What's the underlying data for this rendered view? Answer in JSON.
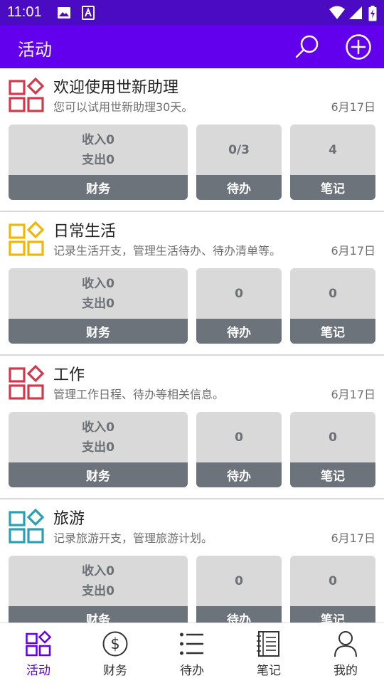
{
  "status_bar": {
    "time": "11:01"
  },
  "app_bar": {
    "title": "活动",
    "search_icon": "search-icon",
    "add_icon": "add-circle-icon"
  },
  "colors": {
    "primary": "#6200ee",
    "status_bar": "#4a0bc2",
    "tile_bg": "#d9d9d9",
    "tile_footer": "#6c737a"
  },
  "tile_labels": {
    "finance": "财务",
    "todo": "待办",
    "notes": "笔记"
  },
  "activities": [
    {
      "name": "欢迎使用世新助理",
      "description": "您可以试用世新助理30天。",
      "date": "6月17日",
      "icon_color": "#d13a4c",
      "income": "收入0",
      "expense": "支出0",
      "todo": "0/3",
      "notes": "4"
    },
    {
      "name": "日常生活",
      "description": "记录生活开支，管理生活待办、待办清单等。",
      "date": "6月17日",
      "icon_color": "#f2b705",
      "income": "收入0",
      "expense": "支出0",
      "todo": "0",
      "notes": "0"
    },
    {
      "name": "工作",
      "description": "管理工作日程、待办等相关信息。",
      "date": "6月17日",
      "icon_color": "#d13a4c",
      "income": "收入0",
      "expense": "支出0",
      "todo": "0",
      "notes": "0"
    },
    {
      "name": "旅游",
      "description": "记录旅游开支，管理旅游计划。",
      "date": "6月17日",
      "icon_color": "#2a9fb5",
      "income": "收入0",
      "expense": "支出0",
      "todo": "0",
      "notes": "0"
    }
  ],
  "bottom_nav": [
    {
      "label": "活动",
      "icon": "activity-icon",
      "active": true
    },
    {
      "label": "财务",
      "icon": "dollar-icon",
      "active": false
    },
    {
      "label": "待办",
      "icon": "list-icon",
      "active": false
    },
    {
      "label": "笔记",
      "icon": "notebook-icon",
      "active": false
    },
    {
      "label": "我的",
      "icon": "person-icon",
      "active": false
    }
  ]
}
